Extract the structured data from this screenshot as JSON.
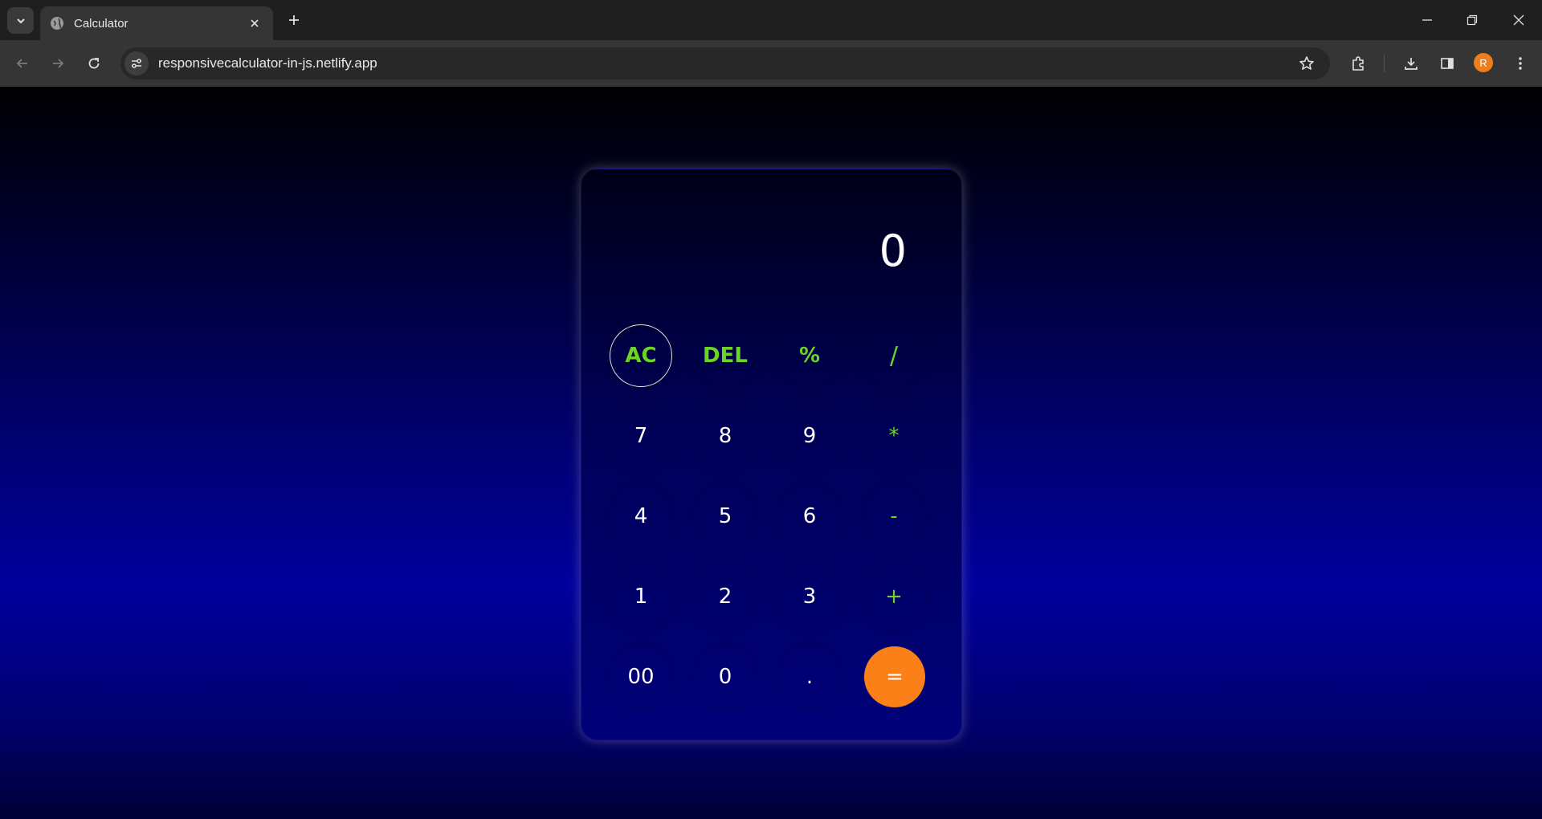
{
  "browser": {
    "tab_title": "Calculator",
    "url": "responsivecalculator-in-js.netlify.app",
    "profile_initial": "R"
  },
  "calculator": {
    "display_value": "0",
    "keys": {
      "ac": "AC",
      "del": "DEL",
      "percent": "%",
      "divide": "/",
      "seven": "7",
      "eight": "8",
      "nine": "9",
      "multiply": "*",
      "four": "4",
      "five": "5",
      "six": "6",
      "minus": "-",
      "one": "1",
      "two": "2",
      "three": "3",
      "plus": "+",
      "double_zero": "00",
      "zero": "0",
      "decimal": ".",
      "equals": "="
    }
  },
  "colors": {
    "operator": "#6ad623",
    "equals": "#fb8018",
    "avatar": "#f07d1c"
  }
}
